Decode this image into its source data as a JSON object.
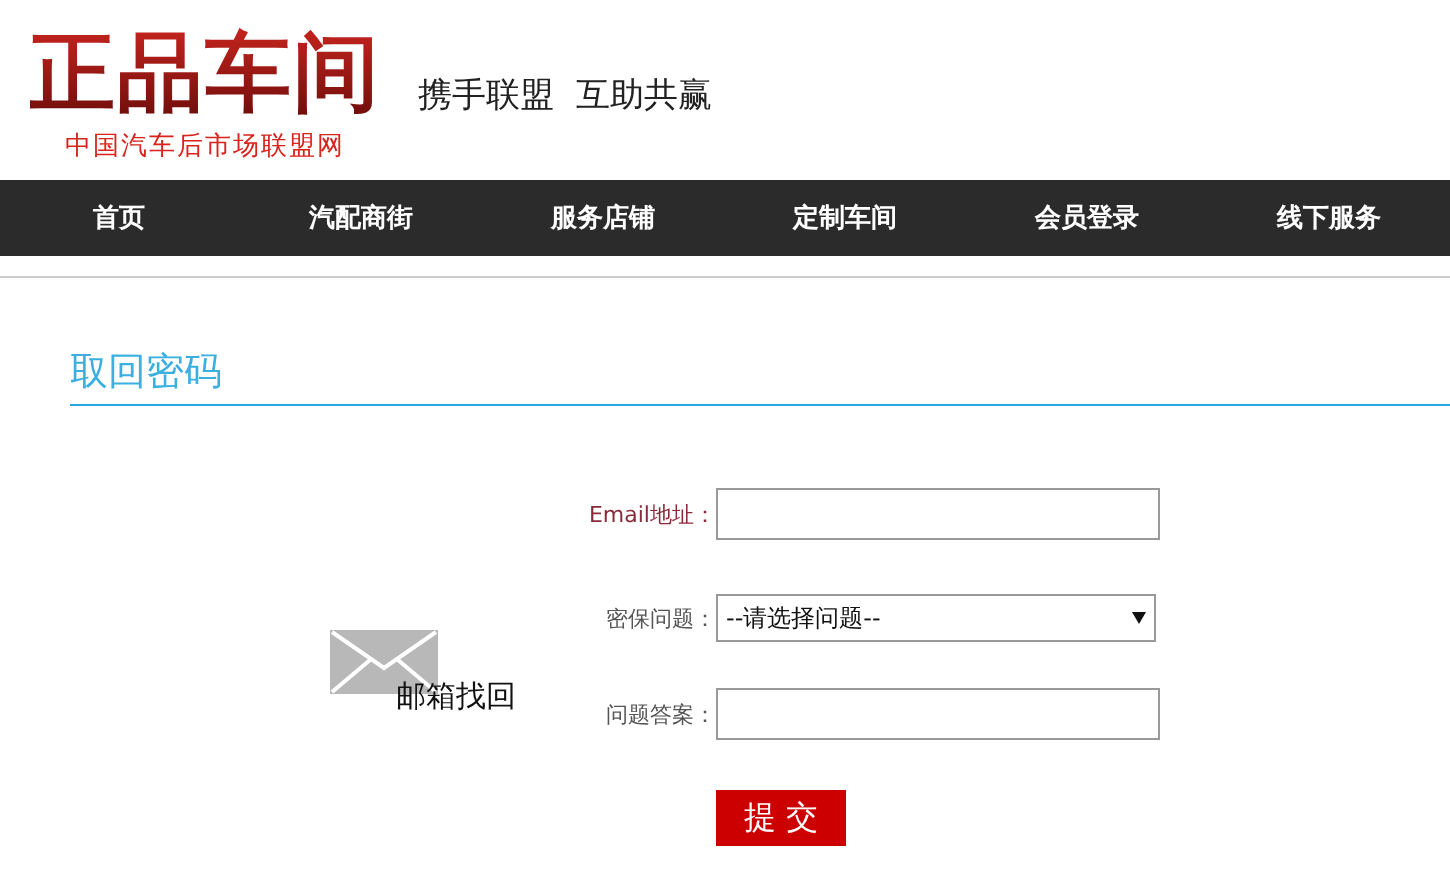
{
  "header": {
    "logo": "正品车间",
    "logo_subtitle": "中国汽车后市场联盟网",
    "slogan": "携手联盟  互助共赢"
  },
  "nav": [
    {
      "label": "首页"
    },
    {
      "label": "汽配商街"
    },
    {
      "label": "服务店铺"
    },
    {
      "label": "定制车间"
    },
    {
      "label": "会员登录"
    },
    {
      "label": "线下服务"
    }
  ],
  "page_title": "取回密码",
  "method": {
    "label": "邮箱找回"
  },
  "form": {
    "fields": [
      {
        "kind": "input",
        "label": "Email地址："
      },
      {
        "kind": "select",
        "label": "密保问题：",
        "value": "--请选择问题--"
      },
      {
        "kind": "input",
        "label": "问题答案："
      }
    ],
    "submit": "提 交"
  }
}
